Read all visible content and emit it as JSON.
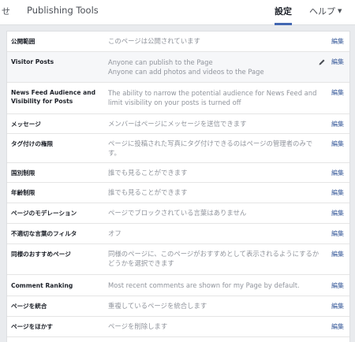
{
  "tabs": {
    "clipped": "せ",
    "publishing_tools": "Publishing Tools",
    "settings": "設定",
    "help": "ヘルプ"
  },
  "edit_label": "編集",
  "rows": [
    {
      "label": "公開範囲",
      "value": "このページは公開されています"
    },
    {
      "label": "Visitor Posts",
      "value": "Anyone can publish to the Page",
      "value2": "Anyone can add photos and videos to the Page"
    },
    {
      "label": "News Feed Audience and Visibility for Posts",
      "value": "The ability to narrow the potential audience for News Feed and limit visibility on your posts is turned off"
    },
    {
      "label": "メッセージ",
      "value": "メンバーはページにメッセージを送信できます"
    },
    {
      "label": "タグ付けの権限",
      "value": "ページに投稿された写真にタグ付けできるのはページの管理者のみです。"
    },
    {
      "label": "国別制限",
      "value": "誰でも見ることができます"
    },
    {
      "label": "年齢制限",
      "value": "誰でも見ることができます"
    },
    {
      "label": "ページのモデレーション",
      "value": "ページでブロックされている言葉はありません"
    },
    {
      "label": "不適切な言葉のフィルタ",
      "value": "オフ"
    },
    {
      "label": "同様のおすすめページ",
      "value": "同様のページに、このページがおすすめとして表示されるようにするかどうかを選択できます"
    },
    {
      "label": "Comment Ranking",
      "value": "Most recent comments are shown for my Page by default."
    },
    {
      "label": "ページを統合",
      "value": "重複しているページを統合します"
    },
    {
      "label": "ページをほかす",
      "value": "ページを削除します"
    }
  ]
}
